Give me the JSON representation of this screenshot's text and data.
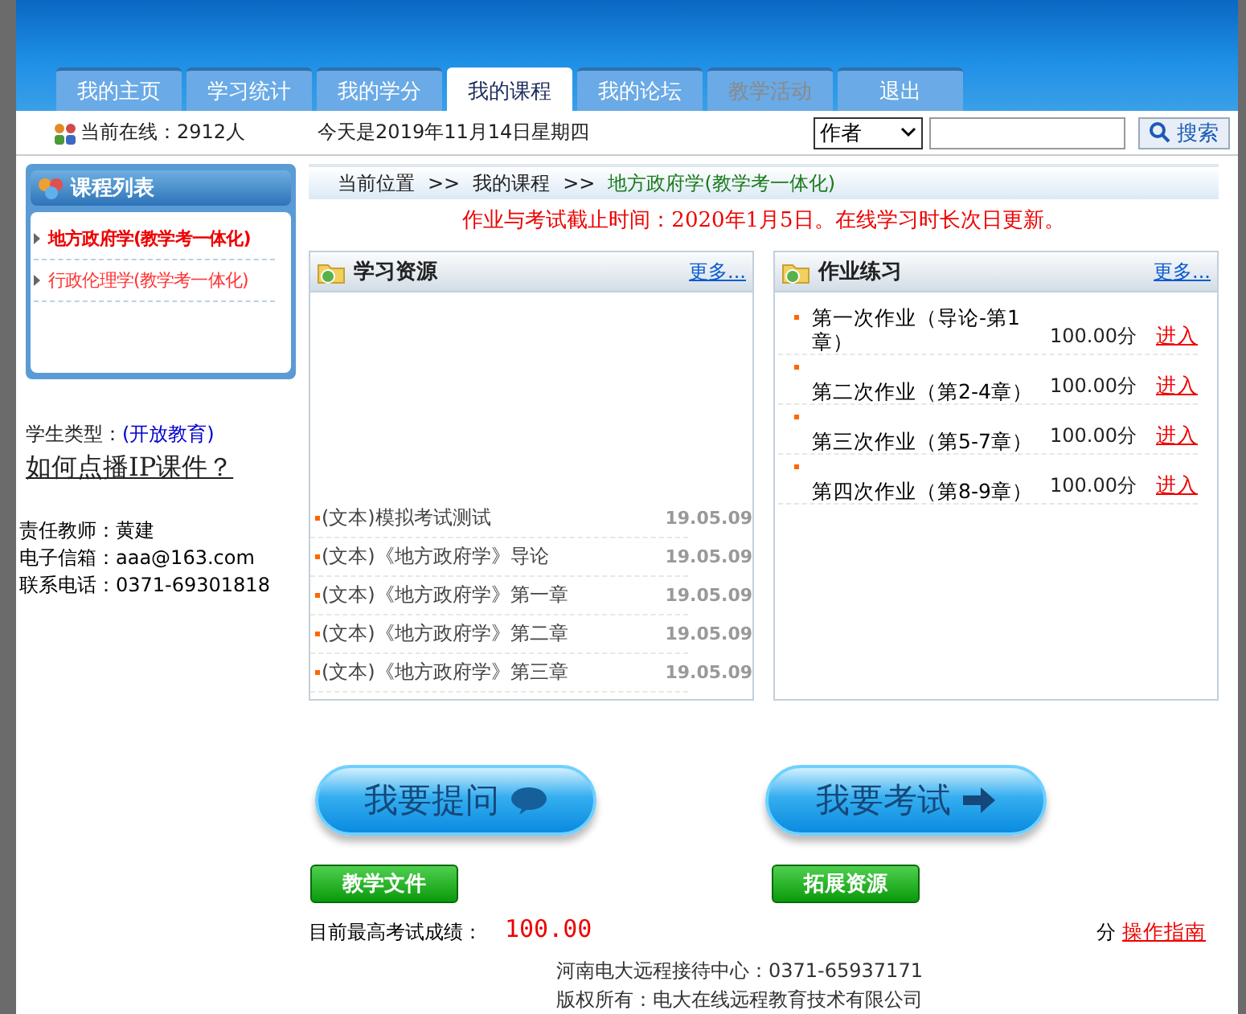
{
  "tabs": [
    {
      "label": "我的主页",
      "selected": false,
      "disabled": false
    },
    {
      "label": "学习统计",
      "selected": false,
      "disabled": false
    },
    {
      "label": "我的学分",
      "selected": false,
      "disabled": false
    },
    {
      "label": "我的课程",
      "selected": true,
      "disabled": false
    },
    {
      "label": "我的论坛",
      "selected": false,
      "disabled": false
    },
    {
      "label": "教学活动",
      "selected": false,
      "disabled": true
    },
    {
      "label": "退出",
      "selected": false,
      "disabled": false
    }
  ],
  "online": "当前在线：2912人",
  "today": "今天是2019年11月14日星期四",
  "search": {
    "select": "作者",
    "button": "搜索"
  },
  "sidebar": {
    "title": "课程列表",
    "courses": [
      {
        "label": "地方政府学(教学考一体化)",
        "selected": true
      },
      {
        "label": "行政伦理学(教学考一体化)",
        "selected": false
      }
    ],
    "student_type_label": "学生类型：",
    "student_type": "(开放教育)",
    "help_link": "如何点播IP课件？",
    "contacts": [
      "责任教师：黄建",
      "电子信箱：aaa@163.com",
      "联系电话：0371-69301818"
    ]
  },
  "breadcrumb": {
    "label": "当前位置",
    "sep": ">>",
    "items": [
      "我的课程",
      "地方政府学(教学考一体化)"
    ]
  },
  "notice": "作业与考试截止时间：2020年1月5日。在线学习时长次日更新。",
  "resources": {
    "title": "学习资源",
    "more": "更多...",
    "items": [
      {
        "title": "(文本)模拟考试测试",
        "date": "19.05.09"
      },
      {
        "title": "(文本)《地方政府学》导论",
        "date": "19.05.09"
      },
      {
        "title": "(文本)《地方政府学》第一章",
        "date": "19.05.09"
      },
      {
        "title": "(文本)《地方政府学》第二章",
        "date": "19.05.09"
      },
      {
        "title": "(文本)《地方政府学》第三章",
        "date": "19.05.09"
      }
    ]
  },
  "homework": {
    "title": "作业练习",
    "more": "更多...",
    "items": [
      {
        "title": "第一次作业（导论-第1章）",
        "score": "100.00分",
        "link": "进入"
      },
      {
        "title": "第二次作业（第2-4章）",
        "score": "100.00分",
        "link": "进入"
      },
      {
        "title": "第三次作业（第5-7章）",
        "score": "100.00分",
        "link": "进入"
      },
      {
        "title": "第四次作业（第8-9章）",
        "score": "100.00分",
        "link": "进入"
      }
    ]
  },
  "big_buttons": [
    {
      "label": "我要提问",
      "kind": "bubble"
    },
    {
      "label": "我要考试",
      "kind": "arrow"
    }
  ],
  "green_buttons": [
    "教学文件",
    "拓展资源"
  ],
  "score": {
    "label": "目前最高考试成绩：",
    "value": "100.00",
    "unit": "分",
    "guide": "操作指南"
  },
  "footer": [
    "河南电大远程接待中心：0371-65937171",
    "版权所有：电大在线远程教育技术有限公司"
  ]
}
